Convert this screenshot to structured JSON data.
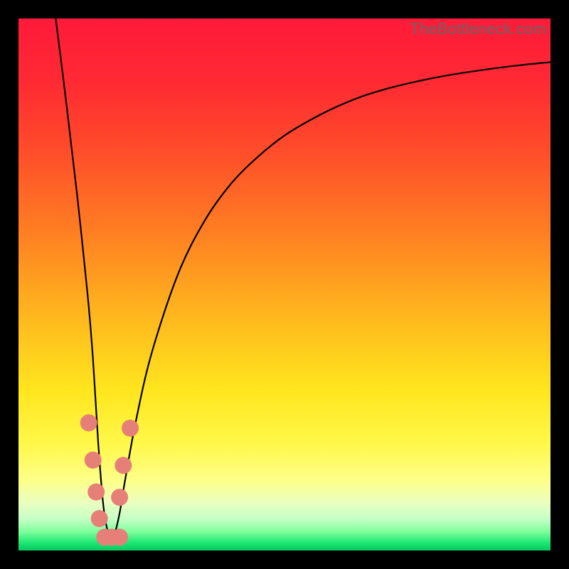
{
  "watermark": "TheBottleneck.com",
  "chart_data": {
    "type": "line",
    "title": "",
    "xlabel": "",
    "ylabel": "",
    "xlim": [
      0,
      100
    ],
    "ylim": [
      0,
      100
    ],
    "grid": false,
    "legend": false,
    "series": [
      {
        "name": "bottleneck-curve",
        "color": "#000000",
        "x": [
          7,
          9,
          11,
          13,
          14,
          15,
          16,
          17,
          18,
          19,
          20,
          22,
          25,
          30,
          35,
          40,
          45,
          50,
          55,
          60,
          65,
          70,
          75,
          80,
          85,
          90,
          95,
          100
        ],
        "y": [
          100,
          84,
          67,
          48,
          36,
          20,
          8,
          3,
          3,
          7,
          13,
          24,
          37,
          52,
          62,
          69,
          74,
          78,
          81,
          83.5,
          85.5,
          87,
          88.2,
          89.2,
          90,
          90.7,
          91.3,
          91.8
        ]
      }
    ],
    "markers": [
      {
        "name": "highlight-points",
        "color": "#e77f79",
        "points": [
          {
            "x": 13.2,
            "y": 24
          },
          {
            "x": 14.0,
            "y": 17
          },
          {
            "x": 14.6,
            "y": 11
          },
          {
            "x": 15.2,
            "y": 6
          },
          {
            "x": 16.2,
            "y": 2.5
          },
          {
            "x": 17.5,
            "y": 2.5
          },
          {
            "x": 19.0,
            "y": 2.5
          },
          {
            "x": 19.0,
            "y": 10
          },
          {
            "x": 19.7,
            "y": 16
          },
          {
            "x": 21.0,
            "y": 23
          }
        ]
      }
    ],
    "gradient_stops": [
      {
        "offset": 0,
        "color": "#ff1a3a"
      },
      {
        "offset": 0.12,
        "color": "#ff2a33"
      },
      {
        "offset": 0.25,
        "color": "#ff4d2a"
      },
      {
        "offset": 0.4,
        "color": "#ff7e22"
      },
      {
        "offset": 0.55,
        "color": "#ffb41e"
      },
      {
        "offset": 0.7,
        "color": "#ffe61e"
      },
      {
        "offset": 0.8,
        "color": "#fff84a"
      },
      {
        "offset": 0.87,
        "color": "#fdff8a"
      },
      {
        "offset": 0.91,
        "color": "#eaffc0"
      },
      {
        "offset": 0.94,
        "color": "#c6ffc6"
      },
      {
        "offset": 0.965,
        "color": "#7dff9a"
      },
      {
        "offset": 0.985,
        "color": "#1fe874"
      },
      {
        "offset": 1.0,
        "color": "#05c95e"
      }
    ]
  }
}
